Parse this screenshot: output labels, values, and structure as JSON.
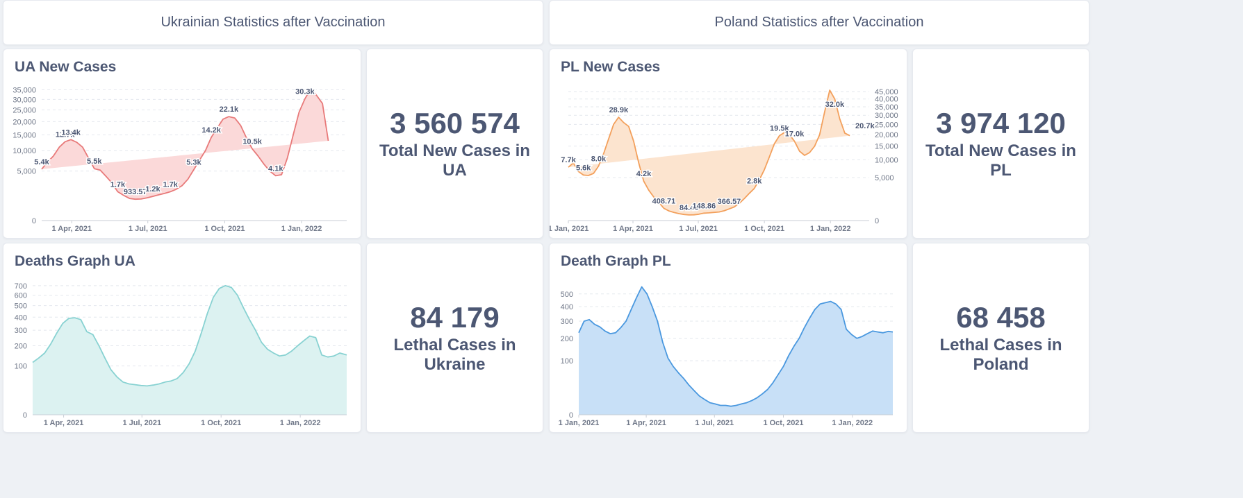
{
  "headers": {
    "ua": "Ukrainian Statistics after Vaccination",
    "pl": "Poland Statistics after Vaccination"
  },
  "stats": {
    "ua_cases": {
      "value": "3 560 574",
      "label": "Total New Cases in UA"
    },
    "pl_cases": {
      "value": "3 974 120",
      "label": "Total New Cases in PL"
    },
    "ua_deaths": {
      "value": "84 179",
      "label": "Lethal Cases in Ukraine"
    },
    "pl_deaths": {
      "value": "68 458",
      "label": "Lethal Cases in Poland"
    }
  },
  "colors": {
    "ua_cases_line": "#e87a7a",
    "ua_cases_fill": "#fbd9d9",
    "pl_cases_line": "#f3a05c",
    "pl_cases_fill": "#fce4cf",
    "ua_deaths_line": "#88d2d2",
    "ua_deaths_fill": "#dcf2f1",
    "pl_deaths_line": "#4a98df",
    "pl_deaths_fill": "#c8e0f7"
  },
  "chart_data": [
    {
      "id": "ua_cases",
      "type": "area",
      "title": "UA New Cases",
      "scale": "sqrt",
      "ylim": [
        0,
        37000
      ],
      "yticks": [
        0,
        5000,
        10000,
        15000,
        20000,
        25000,
        30000,
        35000
      ],
      "ytick_labels": [
        "0",
        "5,000",
        "10,000",
        "15,000",
        "20,000",
        "25,000",
        "30,000",
        "35,000"
      ],
      "y_axis_side": "left",
      "xlim": [
        "2021-02-24",
        "2022-02-24"
      ],
      "xticks": [
        {
          "date": "2021-04-01",
          "label": "1 Apr, 2021"
        },
        {
          "date": "2021-07-01",
          "label": "1 Jul, 2021"
        },
        {
          "date": "2021-10-01",
          "label": "1 Oct, 2021"
        },
        {
          "date": "2022-01-01",
          "label": "1 Jan, 2022"
        }
      ],
      "x": [
        "2021-02-24",
        "2021-03-03",
        "2021-03-10",
        "2021-03-17",
        "2021-03-24",
        "2021-03-31",
        "2021-04-07",
        "2021-04-14",
        "2021-04-21",
        "2021-04-28",
        "2021-05-05",
        "2021-05-12",
        "2021-05-19",
        "2021-05-26",
        "2021-06-02",
        "2021-06-09",
        "2021-06-16",
        "2021-06-23",
        "2021-06-30",
        "2021-07-07",
        "2021-07-14",
        "2021-07-21",
        "2021-07-28",
        "2021-08-04",
        "2021-08-11",
        "2021-08-18",
        "2021-08-25",
        "2021-09-01",
        "2021-09-08",
        "2021-09-15",
        "2021-09-22",
        "2021-09-29",
        "2021-10-06",
        "2021-10-13",
        "2021-10-20",
        "2021-10-27",
        "2021-11-03",
        "2021-11-10",
        "2021-11-17",
        "2021-11-24",
        "2021-12-01",
        "2021-12-08",
        "2021-12-15",
        "2021-12-22",
        "2021-12-29",
        "2022-01-05",
        "2022-01-12",
        "2022-01-19",
        "2022-01-26",
        "2022-02-02",
        "2022-02-09",
        "2022-02-16",
        "2022-02-24"
      ],
      "values": [
        5400,
        7000,
        8500,
        11000,
        12700,
        13400,
        12500,
        11000,
        8000,
        5500,
        5200,
        4000,
        2900,
        1700,
        1300,
        1000,
        933.57,
        950,
        1050,
        1200,
        1350,
        1500,
        1700,
        2000,
        2500,
        3500,
        5300,
        7500,
        10000,
        14200,
        17500,
        21000,
        22100,
        21500,
        18500,
        14000,
        10500,
        8500,
        6500,
        5000,
        4100,
        4300,
        8000,
        15000,
        24000,
        30300,
        35500,
        32000,
        28000,
        13000
      ],
      "data_labels": [
        {
          "date": "2021-02-24",
          "value": 5400,
          "label": "5.4k"
        },
        {
          "date": "2021-03-24",
          "value": 12700,
          "label": "12.7k"
        },
        {
          "date": "2021-03-31",
          "value": 13400,
          "label": "13.4k"
        },
        {
          "date": "2021-04-28",
          "value": 5500,
          "label": "5.5k"
        },
        {
          "date": "2021-05-26",
          "value": 1700,
          "label": "1.7k"
        },
        {
          "date": "2021-06-16",
          "value": 933.57,
          "label": "933.57"
        },
        {
          "date": "2021-07-07",
          "value": 1200,
          "label": "1.2k"
        },
        {
          "date": "2021-07-28",
          "value": 1700,
          "label": "1.7k"
        },
        {
          "date": "2021-08-25",
          "value": 5300,
          "label": "5.3k"
        },
        {
          "date": "2021-09-15",
          "value": 14200,
          "label": "14.2k"
        },
        {
          "date": "2021-10-06",
          "value": 22100,
          "label": "22.1k"
        },
        {
          "date": "2021-11-03",
          "value": 10500,
          "label": "10.5k"
        },
        {
          "date": "2021-12-01",
          "value": 4100,
          "label": "4.1k"
        },
        {
          "date": "2022-01-05",
          "value": 30300,
          "label": "30.3k"
        }
      ]
    },
    {
      "id": "pl_cases",
      "type": "area",
      "title": "PL New Cases",
      "scale": "sqrt",
      "ylim": [
        0,
        49000
      ],
      "yticks": [
        0,
        5000,
        10000,
        15000,
        20000,
        25000,
        30000,
        35000,
        40000,
        45000
      ],
      "ytick_labels": [
        "0",
        "5,000",
        "10,000",
        "15,000",
        "20,000",
        "25,000",
        "30,000",
        "35,000",
        "40,000",
        "45,000"
      ],
      "y_axis_side": "right",
      "xlim": [
        "2021-01-01",
        "2022-02-24"
      ],
      "xticks": [
        {
          "date": "2021-01-01",
          "label": "1 Jan, 2021"
        },
        {
          "date": "2021-04-01",
          "label": "1 Apr, 2021"
        },
        {
          "date": "2021-07-01",
          "label": "1 Jul, 2021"
        },
        {
          "date": "2021-10-01",
          "label": "1 Oct, 2021"
        },
        {
          "date": "2022-01-01",
          "label": "1 Jan, 2022"
        }
      ],
      "x": [
        "2021-01-01",
        "2021-01-08",
        "2021-01-15",
        "2021-01-22",
        "2021-01-29",
        "2021-02-05",
        "2021-02-12",
        "2021-02-19",
        "2021-02-26",
        "2021-03-05",
        "2021-03-12",
        "2021-03-19",
        "2021-03-26",
        "2021-04-02",
        "2021-04-09",
        "2021-04-16",
        "2021-04-23",
        "2021-04-30",
        "2021-05-07",
        "2021-05-14",
        "2021-05-21",
        "2021-05-28",
        "2021-06-04",
        "2021-06-11",
        "2021-06-18",
        "2021-06-25",
        "2021-07-02",
        "2021-07-09",
        "2021-07-16",
        "2021-07-23",
        "2021-07-30",
        "2021-08-06",
        "2021-08-13",
        "2021-08-20",
        "2021-08-27",
        "2021-09-03",
        "2021-09-10",
        "2021-09-17",
        "2021-09-24",
        "2021-10-01",
        "2021-10-08",
        "2021-10-15",
        "2021-10-22",
        "2021-10-29",
        "2021-11-05",
        "2021-11-12",
        "2021-11-19",
        "2021-11-26",
        "2021-12-03",
        "2021-12-10",
        "2021-12-17",
        "2021-12-24",
        "2021-12-31",
        "2022-01-07",
        "2022-01-14",
        "2022-01-21",
        "2022-01-28",
        "2022-02-04",
        "2022-02-11",
        "2022-02-18",
        "2022-02-24"
      ],
      "values": [
        7700,
        9000,
        6500,
        5600,
        5500,
        6000,
        8000,
        12000,
        18000,
        25000,
        28900,
        26000,
        24000,
        17000,
        9000,
        4200,
        2500,
        1500,
        900,
        408.71,
        250,
        180,
        130,
        100,
        84.43,
        90,
        110,
        148.86,
        160,
        180,
        200,
        260,
        366.57,
        500,
        800,
        1300,
        2000,
        2800,
        4500,
        7000,
        11000,
        16000,
        19500,
        21000,
        20000,
        17000,
        13000,
        11500,
        12500,
        15000,
        20000,
        32000,
        46000,
        40000,
        28000,
        20700,
        19500
      ],
      "data_labels": [
        {
          "date": "2021-01-01",
          "value": 7700,
          "label": "7.7k"
        },
        {
          "date": "2021-01-22",
          "value": 5600,
          "label": "5.6k"
        },
        {
          "date": "2021-02-12",
          "value": 8000,
          "label": "8.0k"
        },
        {
          "date": "2021-03-12",
          "value": 28900,
          "label": "28.9k"
        },
        {
          "date": "2021-04-16",
          "value": 4200,
          "label": "4.2k"
        },
        {
          "date": "2021-05-14",
          "value": 408.71,
          "label": "408.71"
        },
        {
          "date": "2021-06-18",
          "value": 84.43,
          "label": "84.43"
        },
        {
          "date": "2021-07-09",
          "value": 148.86,
          "label": "148.86"
        },
        {
          "date": "2021-08-13",
          "value": 366.57,
          "label": "366.57"
        },
        {
          "date": "2021-09-17",
          "value": 2800,
          "label": "2.8k"
        },
        {
          "date": "2021-10-22",
          "value": 19500,
          "label": "19.5k"
        },
        {
          "date": "2021-11-12",
          "value": 17000,
          "label": "17.0k"
        },
        {
          "date": "2022-01-07",
          "value": 32000,
          "label": "32.0k"
        },
        {
          "date": "2022-02-18",
          "value": 20700,
          "label": "20.7k"
        }
      ]
    },
    {
      "id": "ua_deaths",
      "type": "area",
      "title": "Deaths Graph UA",
      "scale": "sqrt",
      "ylim": [
        0,
        760
      ],
      "yticks": [
        0,
        100,
        200,
        300,
        400,
        500,
        600,
        700
      ],
      "ytick_labels": [
        "0",
        "100",
        "200",
        "300",
        "400",
        "500",
        "600",
        "700"
      ],
      "y_axis_side": "left",
      "xlim": [
        "2021-02-24",
        "2022-02-24"
      ],
      "xticks": [
        {
          "date": "2021-04-01",
          "label": "1 Apr, 2021"
        },
        {
          "date": "2021-07-01",
          "label": "1 Jul, 2021"
        },
        {
          "date": "2021-10-01",
          "label": "1 Oct, 2021"
        },
        {
          "date": "2022-01-01",
          "label": "1 Jan, 2022"
        }
      ],
      "x": [
        "2021-02-24",
        "2021-03-03",
        "2021-03-10",
        "2021-03-17",
        "2021-03-24",
        "2021-03-31",
        "2021-04-07",
        "2021-04-14",
        "2021-04-21",
        "2021-04-28",
        "2021-05-05",
        "2021-05-12",
        "2021-05-19",
        "2021-05-26",
        "2021-06-02",
        "2021-06-09",
        "2021-06-16",
        "2021-06-23",
        "2021-06-30",
        "2021-07-07",
        "2021-07-14",
        "2021-07-21",
        "2021-07-28",
        "2021-08-04",
        "2021-08-11",
        "2021-08-18",
        "2021-08-25",
        "2021-09-01",
        "2021-09-08",
        "2021-09-15",
        "2021-09-22",
        "2021-09-29",
        "2021-10-06",
        "2021-10-13",
        "2021-10-20",
        "2021-10-27",
        "2021-11-03",
        "2021-11-10",
        "2021-11-17",
        "2021-11-24",
        "2021-12-01",
        "2021-12-08",
        "2021-12-15",
        "2021-12-22",
        "2021-12-29",
        "2022-01-05",
        "2022-01-12",
        "2022-01-19",
        "2022-01-26",
        "2022-02-02",
        "2022-02-09",
        "2022-02-16",
        "2022-02-24"
      ],
      "values": [
        115,
        135,
        160,
        210,
        280,
        350,
        390,
        395,
        380,
        290,
        270,
        200,
        135,
        85,
        60,
        45,
        40,
        38,
        36,
        35,
        37,
        40,
        45,
        48,
        55,
        75,
        110,
        170,
        280,
        430,
        580,
        670,
        700,
        680,
        600,
        480,
        380,
        300,
        220,
        180,
        160,
        145,
        150,
        170,
        200,
        230,
        260,
        250,
        150,
        140,
        145,
        160,
        150
      ]
    },
    {
      "id": "pl_deaths",
      "type": "area",
      "title": "Death Graph PL",
      "scale": "sqrt",
      "ylim": [
        0,
        620
      ],
      "yticks": [
        0,
        100,
        200,
        300,
        400,
        500
      ],
      "ytick_labels": [
        "0",
        "100",
        "200",
        "300",
        "400",
        "500"
      ],
      "y_axis_side": "left",
      "xlim": [
        "2021-01-01",
        "2022-02-24"
      ],
      "xticks": [
        {
          "date": "2021-01-01",
          "label": "1 Jan, 2021"
        },
        {
          "date": "2021-04-01",
          "label": "1 Apr, 2021"
        },
        {
          "date": "2021-07-01",
          "label": "1 Jul, 2021"
        },
        {
          "date": "2021-10-01",
          "label": "1 Oct, 2021"
        },
        {
          "date": "2022-01-01",
          "label": "1 Jan, 2022"
        }
      ],
      "x": [
        "2021-01-01",
        "2021-01-08",
        "2021-01-15",
        "2021-01-22",
        "2021-01-29",
        "2021-02-05",
        "2021-02-12",
        "2021-02-19",
        "2021-02-26",
        "2021-03-05",
        "2021-03-12",
        "2021-03-19",
        "2021-03-26",
        "2021-04-02",
        "2021-04-09",
        "2021-04-16",
        "2021-04-23",
        "2021-04-30",
        "2021-05-07",
        "2021-05-14",
        "2021-05-21",
        "2021-05-28",
        "2021-06-04",
        "2021-06-11",
        "2021-06-18",
        "2021-06-25",
        "2021-07-02",
        "2021-07-09",
        "2021-07-16",
        "2021-07-23",
        "2021-07-30",
        "2021-08-06",
        "2021-08-13",
        "2021-08-20",
        "2021-08-27",
        "2021-09-03",
        "2021-09-10",
        "2021-09-17",
        "2021-09-24",
        "2021-10-01",
        "2021-10-08",
        "2021-10-15",
        "2021-10-22",
        "2021-10-29",
        "2021-11-05",
        "2021-11-12",
        "2021-11-19",
        "2021-11-26",
        "2021-12-03",
        "2021-12-10",
        "2021-12-17",
        "2021-12-24",
        "2021-12-31",
        "2022-01-07",
        "2022-01-14",
        "2022-01-21",
        "2022-01-28",
        "2022-02-04",
        "2022-02-11",
        "2022-02-18",
        "2022-02-24"
      ],
      "values": [
        230,
        300,
        310,
        280,
        265,
        240,
        225,
        230,
        260,
        300,
        380,
        470,
        560,
        500,
        400,
        300,
        180,
        110,
        80,
        60,
        45,
        30,
        20,
        12,
        8,
        5,
        4,
        3,
        3,
        2.5,
        3,
        4,
        5,
        7,
        10,
        15,
        22,
        35,
        55,
        80,
        120,
        160,
        200,
        260,
        320,
        380,
        420,
        430,
        440,
        420,
        380,
        250,
        220,
        200,
        210,
        225,
        240,
        235,
        230,
        238,
        235
      ]
    }
  ]
}
